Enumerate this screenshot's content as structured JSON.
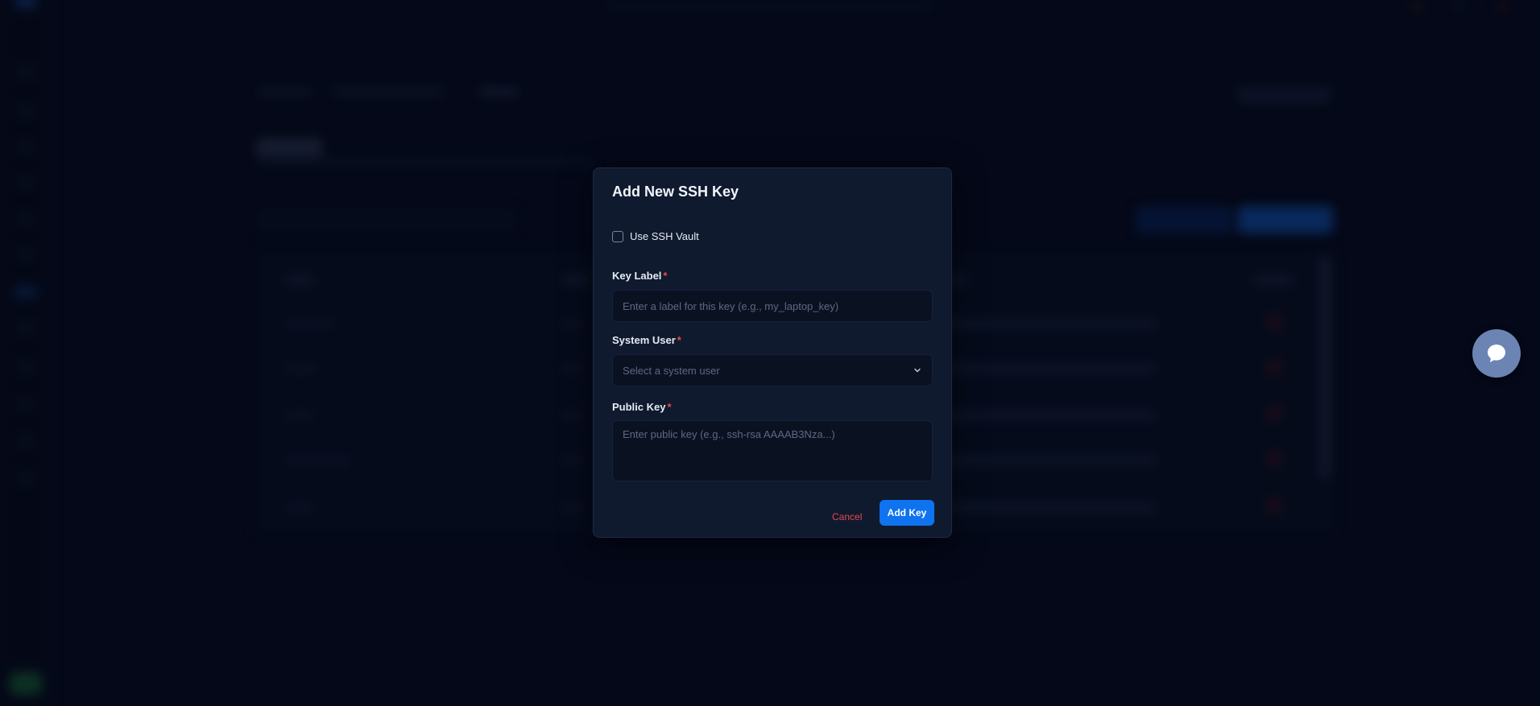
{
  "modal": {
    "title": "Add New SSH Key",
    "use_vault_label": "Use SSH Vault",
    "use_vault_checked": false,
    "key_label": {
      "label": "Key Label",
      "required_mark": "*",
      "value": "",
      "placeholder": "Enter a label for this key (e.g., my_laptop_key)"
    },
    "system_user": {
      "label": "System User",
      "required_mark": "*",
      "placeholder": "Select a system user"
    },
    "public_key": {
      "label": "Public Key",
      "required_mark": "*",
      "value": "",
      "placeholder": "Enter public key (e.g., ssh-rsa AAAAB3Nza...)"
    },
    "cancel_label": "Cancel",
    "submit_label": "Add Key"
  },
  "icons": {
    "chevron": "chevron-down-icon",
    "chat": "chat-bubble-icon",
    "checkbox": "checkbox-unchecked"
  },
  "colors": {
    "background": "#050a1c",
    "modal_bg": "#0f1a2f",
    "input_bg": "#0a1222",
    "primary": "#0f73f0",
    "danger": "#e5484d",
    "chat_bubble": "#6b84b4"
  }
}
